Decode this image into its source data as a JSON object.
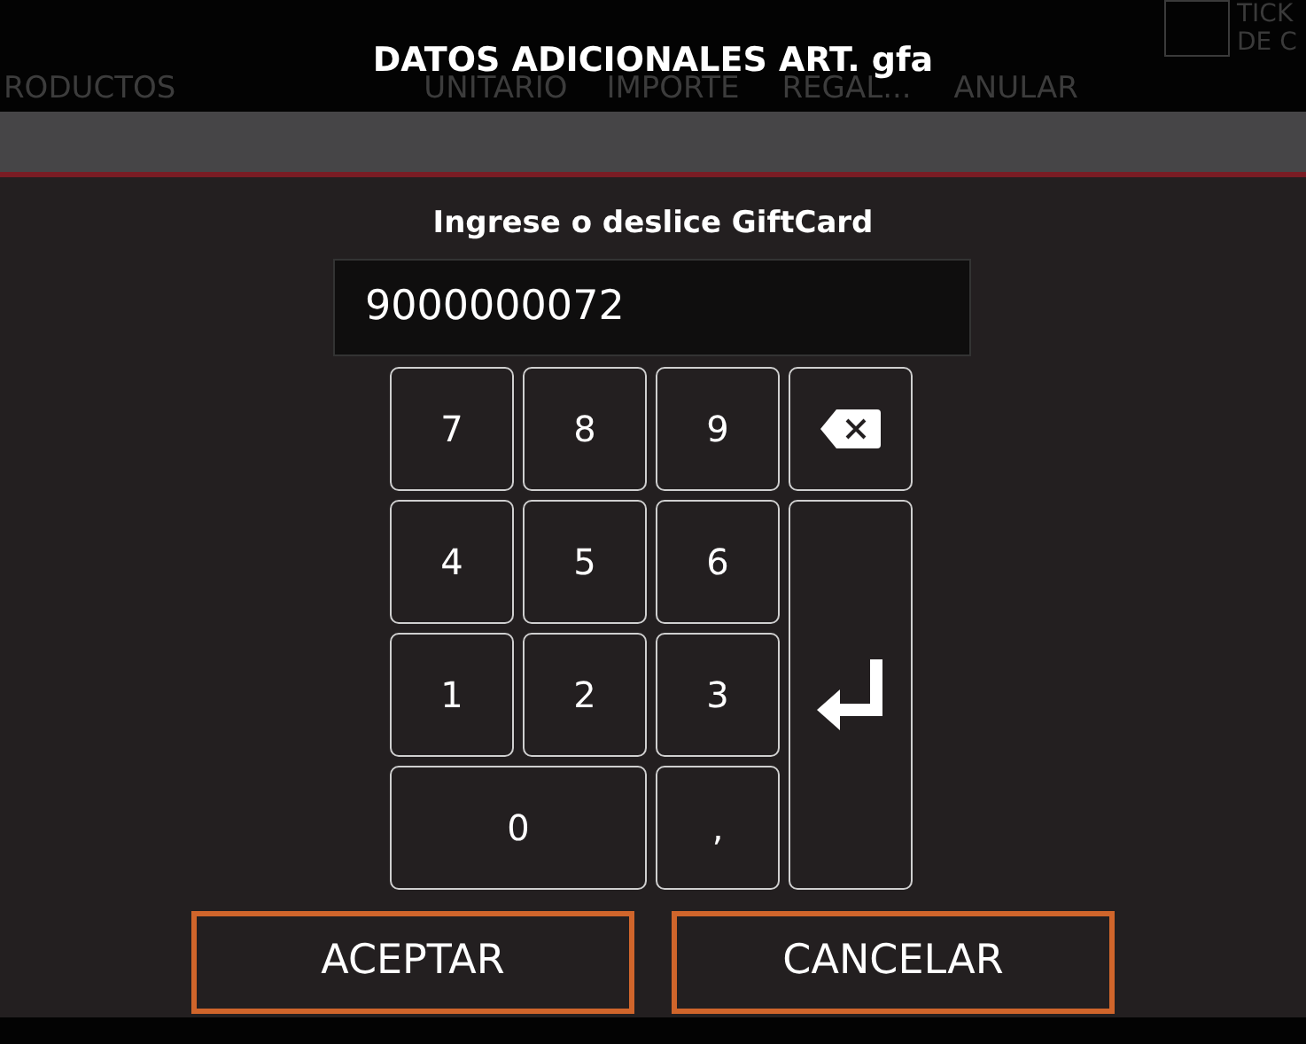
{
  "background_header": {
    "columns": [
      "RODUCTOS",
      "UNITARIO",
      "IMPORTE",
      "REGAL...",
      "ANULAR"
    ],
    "corner_lines": [
      "TICK",
      "DE C"
    ],
    "checkbox": {
      "checked": false
    }
  },
  "dialog": {
    "title": "DATOS ADICIONALES ART. gfa",
    "prompt": "Ingrese o deslice GiftCard",
    "input": {
      "value": "9000000072"
    },
    "keys": [
      {
        "kind": "digit",
        "label": "7"
      },
      {
        "kind": "digit",
        "label": "8"
      },
      {
        "kind": "digit",
        "label": "9"
      },
      {
        "kind": "backspace"
      },
      {
        "kind": "digit",
        "label": "4"
      },
      {
        "kind": "digit",
        "label": "5"
      },
      {
        "kind": "digit",
        "label": "6"
      },
      {
        "kind": "enter"
      },
      {
        "kind": "digit",
        "label": "1"
      },
      {
        "kind": "digit",
        "label": "2"
      },
      {
        "kind": "digit",
        "label": "3"
      },
      {
        "kind": "wide",
        "label": "0"
      },
      {
        "kind": "digit",
        "label": ","
      }
    ],
    "buttons": [
      "ACEPTAR",
      "CANCELAR"
    ]
  }
}
